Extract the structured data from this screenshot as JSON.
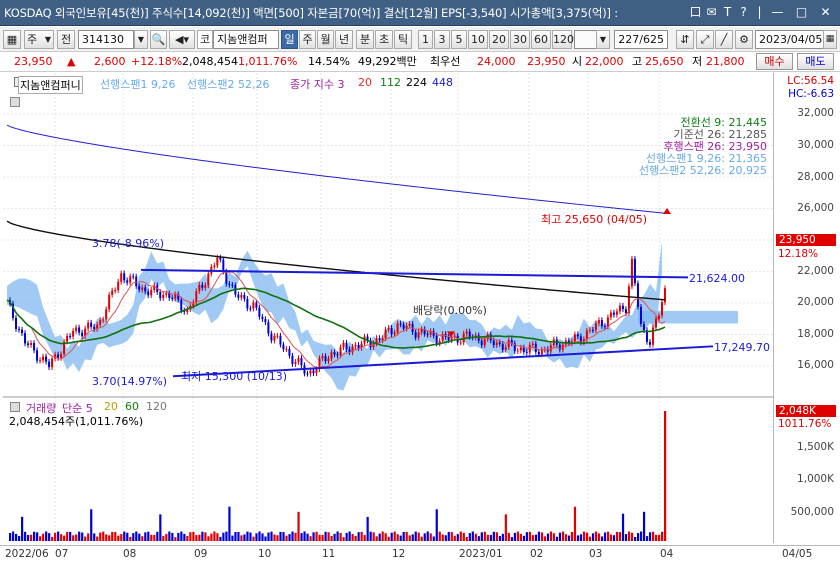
{
  "window": {
    "title": "KOSDAQ 외국인보유[45(천)] 주식수[14,092(천)] 액면[500] 자본금[70(억)] 결산[12월] EPS[-3,540] 시가총액[3,375(억)] :",
    "controls": [
      "口",
      "✉",
      "T",
      "?",
      "|",
      "—",
      "□",
      "✕"
    ]
  },
  "toolbar": {
    "market": "주",
    "seq": "전",
    "code": "314130",
    "kind": "코",
    "name": "지놈앤컴퍼",
    "periods": [
      "일",
      "주",
      "월",
      "년",
      "분",
      "초",
      "틱"
    ],
    "selected_period": "일",
    "intervals": [
      "1",
      "3",
      "5",
      "10",
      "20",
      "30",
      "60",
      "120"
    ],
    "count": "227/625",
    "date": "2023/04/05"
  },
  "quote": {
    "price": "23,950",
    "arrow": "▲",
    "change": "2,600",
    "rate": "+12.18%",
    "volume": "2,048,454",
    "vol_rate": "1,011.76%",
    "turnover": "14.54%",
    "amount": "49,292백만",
    "pref_label": "최우선",
    "ask": "24,000",
    "bid": "23,950",
    "open_label": "시",
    "open": "22,000",
    "high_label": "고",
    "high": "25,650",
    "low_label": "저",
    "low": "21,800",
    "buy_btn": "매수",
    "sell_btn": "매도"
  },
  "price_legend": {
    "name": "지놈앤컴퍼니",
    "span1": "선행스팬1 9,26",
    "span2": "선행스팬2 52,26",
    "ma_label": "종가 지수 3",
    "ma": [
      "20",
      "112",
      "224",
      "448"
    ]
  },
  "ichimoku_box": [
    "전환선 9: 21,445",
    "기준선 26: 21,285",
    "후행스팬 26: 23,950",
    "선행스팬1 9,26: 21,365",
    "선행스팬2 52,26: 20,925"
  ],
  "annotations": {
    "high": "최고 25,650 (04/05)",
    "low": "최저 15,300 (10/13)",
    "dividend": "배당락(0.00%)",
    "upper_trend_left": "3.78(-8.96%)",
    "upper_trend_right": "21,624.00",
    "lower_trend_left": "3.70(14.97%)",
    "lower_trend_right": "17,249.70"
  },
  "price_axis": {
    "lc": "LC:56.54",
    "hc": "HC:-6.63",
    "ticks": [
      "32,000",
      "30,000",
      "28,000",
      "26,000",
      "22,000",
      "20,000",
      "18,000",
      "16,000"
    ],
    "current": "23,950",
    "current_rate": "12.18%"
  },
  "volume_legend": {
    "label": "거래량",
    "ma_label": "단순 5",
    "ma": [
      "20",
      "60",
      "120"
    ],
    "value": "2,048,454주(1,011.76%)"
  },
  "volume_axis": {
    "ticks": [
      "1,500K",
      "1,000K",
      "500,000"
    ],
    "current": "2,048K",
    "current_rate": "1011.76%"
  },
  "dates": [
    "2022/06",
    "07",
    "08",
    "09",
    "10",
    "11",
    "12",
    "2023/01",
    "02",
    "03",
    "04",
    "04/05"
  ],
  "colors": {
    "title_bg": "#3f5f84",
    "up": "#e00000",
    "down": "#0000d0",
    "cloud": "#80b8f0",
    "ma20": "#e05050",
    "ma112": "#107010",
    "ma224": "#101010",
    "ma448": "#2020d0",
    "trend": "#1a1ad8"
  }
}
